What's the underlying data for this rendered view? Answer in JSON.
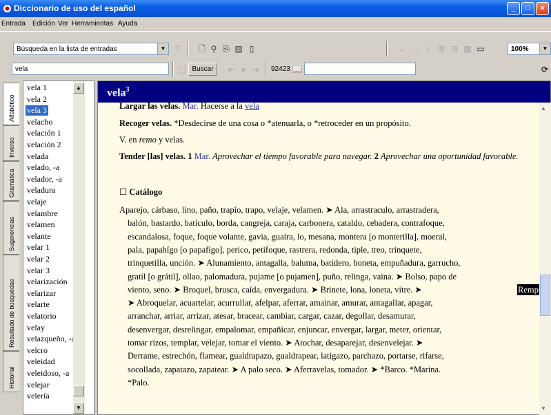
{
  "window": {
    "title": "Diccionario de uso del español",
    "minimize_label": "_",
    "maximize_label": "□",
    "close_label": "×"
  },
  "menu": {
    "items": [
      "Entrada",
      "Edición",
      "Ver",
      "Herramientas",
      "Ayuda"
    ]
  },
  "toolbar": {
    "search_mode": "Búsqueda en la lista de entradas",
    "zoom": "100%",
    "search_value": "vela",
    "buscar_label": "Buscar",
    "entry_number": "92423"
  },
  "tabs": [
    "Alfabético",
    "Inverso",
    "Gramática",
    "Sugerencias",
    "Resultado de búsquedas",
    "Historial"
  ],
  "wordlist": {
    "items": [
      "vela 1",
      "vela 2",
      "vela 3",
      "velacho",
      "velación 1",
      "velación 2",
      "velada",
      "velado, -a",
      "velador, -a",
      "veladura",
      "velaje",
      "velambre",
      "velamen",
      "velante",
      "velar 1",
      "velar 2",
      "velar 3",
      "velarización",
      "velarizar",
      "velarte",
      "velatorio",
      "velay",
      "velazqueño, -a",
      "velcro",
      "veleidad",
      "veleidoso, -a",
      "velejar",
      "velería"
    ],
    "selected_index": 2
  },
  "article": {
    "headword": "vela",
    "sense_number": "3",
    "line_cut": {
      "phrase": "Largar las velas.",
      "label": "Mar.",
      "def": "Hacerse a la",
      "link": "vela"
    },
    "recoger": {
      "phrase": "Recoger velas.",
      "def": "*Desdecirse de una cosa o *atenuarla, o *retroceder en un propósito."
    },
    "ver": {
      "prefix": "V. en",
      "ref": "remo",
      "suffix": "y velas."
    },
    "tender": {
      "phrase": "Tender [las] velas.",
      "n1": "1",
      "label": "Mar.",
      "def1": "Aprovechar el tiempo favorable para navegar.",
      "n2": "2",
      "def2": "Aprovechar una oportunidad favorable."
    },
    "catalogo_title": "Catálogo",
    "catalogo_lines": [
      "Aparejo, cárbaso, lino, paño, trapío, trapo, velaje, velamen. ➤ Ala, arrastraculo, arrastradera,",
      "balón, bastardo, batículo, borda, cangreja, caraja, carbonera, cataldo, cebadera, contrafoque,",
      "escandalosa, foque, foque volante, gavia, guaira, lo, mesana, montera [o monterilla], moeral,",
      "pala, papahígo [o papafigo], perico, petifoque, rastrera, redonda, tiple, treo, trinquete,",
      "trinquetilla, unción. ➤ Alunamiento, antagalla, baluma, batidero, boneta, empuñadura, garrucho,",
      "gratil [o grátil], ollao, palomadura, pujame [o pujamen], puño, relinga, vaina. ➤ Bolso, papo de",
      "viento, seno. ➤ Broquel, brusca, caída, envergadura. ➤ Brinete, lona, loneta, vitre. ➤",
      "➤ Abroquelar, acuartelar, acurrullar, afelpar, aferrar, amainar, amurar, antagallar, apagar,",
      "arranchar, arriar, arrizar, atesar, bracear, cambiar, cargar, cazar, degollar, desamurar,",
      "desenvergar, desrelingar, empalomar, empañicar, enjuncar, envergar, largar, meter, orientar,",
      "tomar rizos, templar, velejar, tomar el viento. ➤ Atochar, desaparejar, desenvelejar. ➤",
      "Derrame, estrechón, flamear, gualdrapazo, gualdrapear, latigazo, parchazo, portarse, rifarse,",
      "socollada, zapatazo, zapatear. ➤ A palo seco. ➤ Aferravelas, tomador. ➤ *Barco. *Marina.",
      "*Palo."
    ],
    "highlight": "Rempujo."
  },
  "colors": {
    "titlebar": "#0a5ee6",
    "header_band": "#000080",
    "page_bg": "#fffbe6",
    "selection": "#316ac5"
  }
}
